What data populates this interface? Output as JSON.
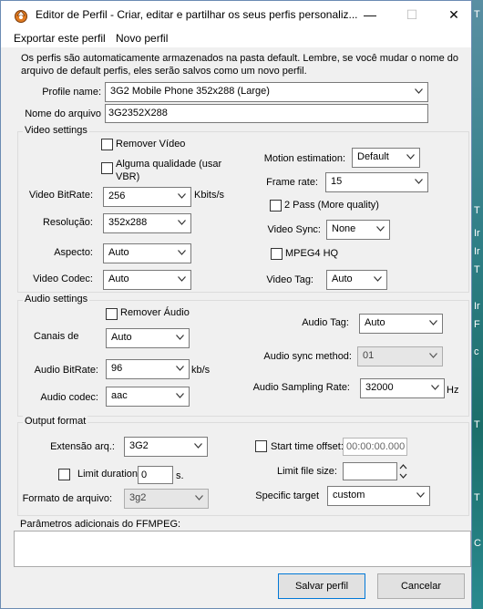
{
  "window": {
    "title": "Editor de Perfil - Criar, editar e partilhar os seus perfis personaliz...",
    "minimize": "—",
    "maximize": "☐",
    "close": "✕"
  },
  "background": {
    "letters": [
      "T",
      "T",
      "Ir",
      "Ir",
      "T",
      "Ir",
      "F",
      "c",
      "T",
      "T",
      "C"
    ]
  },
  "menu": {
    "export": "Exportar este perfil",
    "new": "Novo perfil"
  },
  "info": "Os perfis são automaticamente armazenados na pasta default. Lembre, se você mudar o nome do arquivo de default perfis, eles serão salvos como um novo perfil.",
  "profile": {
    "name_label": "Profile name:",
    "name_value": "3G2 Mobile Phone 352x288 (Large)",
    "file_label": "Nome do arquivo",
    "file_value": "3G2352X288"
  },
  "video": {
    "group": "Video settings",
    "remove": "Remover Vídeo",
    "quality": "Alguma qualidade (usar VBR)",
    "bitrate_label": "Video BitRate:",
    "bitrate_value": "256",
    "bitrate_unit": "Kbits/s",
    "resolution_label": "Resolução:",
    "resolution_value": "352x288",
    "aspect_label": "Aspecto:",
    "aspect_value": "Auto",
    "codec_label": "Video Codec:",
    "codec_value": "Auto",
    "motion_label": "Motion estimation:",
    "motion_value": "Default",
    "framerate_label": "Frame rate:",
    "framerate_value": "15",
    "twopass": "2 Pass (More quality)",
    "sync_label": "Video Sync:",
    "sync_value": "None",
    "mpeg4hq": "MPEG4 HQ",
    "tag_label": "Video Tag:",
    "tag_value": "Auto"
  },
  "audio": {
    "group": "Audio settings",
    "remove": "Remover Áudio",
    "channels_label": "Canais de",
    "channels_value": "Auto",
    "bitrate_label": "Audio BitRate:",
    "bitrate_value": "96",
    "bitrate_unit": "kb/s",
    "codec_label": "Audio codec:",
    "codec_value": "aac",
    "tag_label": "Audio Tag:",
    "tag_value": "Auto",
    "sync_label": "Audio sync method:",
    "sync_value": "01",
    "rate_label": "Audio Sampling Rate:",
    "rate_value": "32000",
    "rate_unit": "Hz"
  },
  "output": {
    "group": "Output format",
    "ext_label": "Extensão arq.:",
    "ext_value": "3G2",
    "limit_label": "Limit duration:",
    "limit_value": "0",
    "limit_unit": "s.",
    "format_label": "Formato de arquivo:",
    "format_value": "3g2",
    "start_label": "Start time offset:",
    "start_value": "00:00:00.000",
    "size_label": "Limit file size:",
    "size_value": "",
    "target_label": "Specific target",
    "target_value": "custom"
  },
  "ffmpeg": {
    "label": "Parâmetros adicionais do FFMPEG:",
    "value": ""
  },
  "buttons": {
    "save": "Salvar perfil",
    "cancel": "Cancelar"
  }
}
